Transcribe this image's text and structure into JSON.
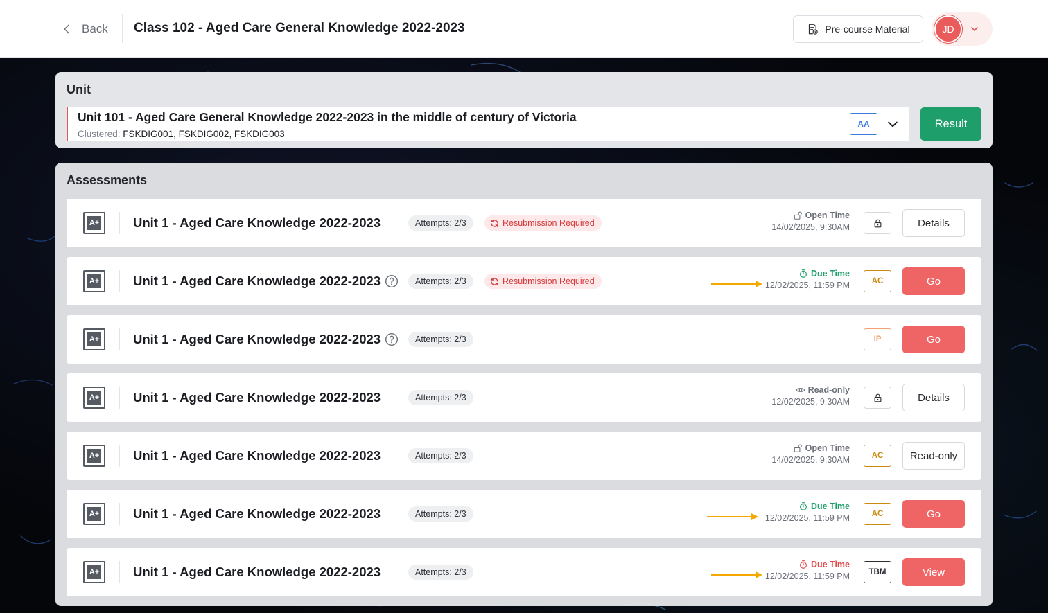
{
  "header": {
    "back_label": "Back",
    "title": "Class 102 - Aged Care General Knowledge 2022-2023",
    "precourse_label": "Pre-course Material",
    "user_initials": "JD"
  },
  "unit": {
    "heading": "Unit",
    "selected_title": "Unit 101 - Aged Care General Knowledge 2022-2023 in the middle of century of Victoria",
    "clustered_label": "Clustered:",
    "clustered_codes": "FSKDIG001, FSKDIG002, FSKDIG003",
    "badge": "AA",
    "result_label": "Result"
  },
  "assessments": {
    "heading": "Assessments",
    "grade_icon_text": "A+",
    "rows": [
      {
        "title": "Unit 1 - Aged Care Knowledge 2022-2023",
        "attempts": "Attempts: 2/3",
        "resubmission": "Resubmission Required",
        "time_label": "Open Time",
        "time_value": "14/02/2025, 9:30AM",
        "action": "Details"
      },
      {
        "title": "Unit 1 - Aged Care Knowledge 2022-2023",
        "attempts": "Attempts: 2/3",
        "resubmission": "Resubmission Required",
        "time_label": "Due Time",
        "time_value": "12/02/2025, 11:59 PM",
        "badge": "AC",
        "action": "Go"
      },
      {
        "title": "Unit 1 - Aged Care Knowledge 2022-2023",
        "attempts": "Attempts: 2/3",
        "badge": "IP",
        "action": "Go"
      },
      {
        "title": "Unit 1 - Aged Care Knowledge 2022-2023",
        "attempts": "Attempts: 2/3",
        "time_label": "Read-only",
        "time_value": "12/02/2025, 9:30AM",
        "action": "Details"
      },
      {
        "title": "Unit 1 - Aged Care Knowledge 2022-2023",
        "attempts": "Attempts: 2/3",
        "time_label": "Open Time",
        "time_value": "14/02/2025, 9:30AM",
        "badge": "AC",
        "action": "Read-only"
      },
      {
        "title": "Unit 1 - Aged Care Knowledge 2022-2023",
        "attempts": "Attempts: 2/3",
        "time_label": "Due Time",
        "time_value": "12/02/2025, 11:59 PM",
        "badge": "AC",
        "action": "Go"
      },
      {
        "title": "Unit 1 - Aged Care Knowledge 2022-2023",
        "attempts": "Attempts: 2/3",
        "time_label": "Due Time",
        "time_value": "12/02/2025, 11:59 PM",
        "badge": "TBM",
        "action": "View"
      }
    ]
  },
  "colors": {
    "primary_red": "#ef6565",
    "result_green": "#1e9e6a",
    "due_green": "#1e9e6a",
    "overdue_red": "#e04848",
    "annotation_arrow": "#f5a800",
    "badge_ac": "#c98a10",
    "badge_ip": "#f2a074",
    "badge_aa": "#3b7be0"
  }
}
